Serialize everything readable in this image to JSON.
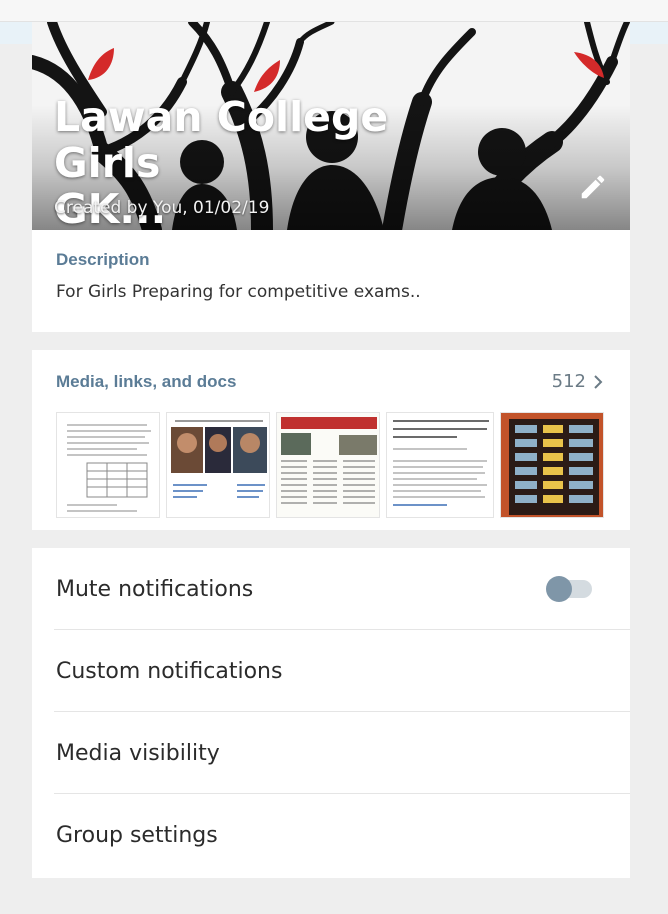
{
  "header": {
    "group_name_line1": "Lawan College Girls",
    "group_name_line2": "GK...",
    "created_text": "Created by You, 01/02/19",
    "edit_icon": "pencil-icon"
  },
  "description": {
    "label": "Description",
    "text": "For Girls Preparing for competitive exams.."
  },
  "media": {
    "label": "Media, links, and docs",
    "count": "512",
    "arrow_icon": "chevron-right-icon",
    "thumbnails": [
      "document-thumbnail",
      "news-thumbnail",
      "newspaper-thumbnail",
      "article-thumbnail",
      "table-thumbnail"
    ]
  },
  "settings": {
    "mute_label": "Mute notifications",
    "mute_enabled": false,
    "custom_label": "Custom notifications",
    "visibility_label": "Media visibility",
    "group_settings_label": "Group settings"
  },
  "colors": {
    "accent_label": "#5b7c96",
    "toggle_knob": "#7f96a8",
    "toggle_track": "#d4dbe0",
    "leaf_red": "#d42a2a"
  }
}
